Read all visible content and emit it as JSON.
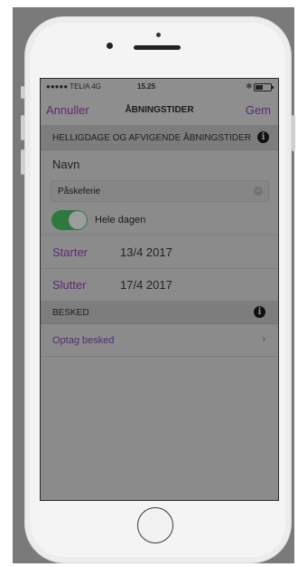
{
  "status_bar": {
    "carrier": "●●●●● TELIA 4G",
    "time": "15.25",
    "bluetooth": "✱"
  },
  "nav": {
    "left_label": "Annuller",
    "title": "ÅBNINGSTIDER",
    "right_label": "Gem"
  },
  "section1": {
    "title": "HELLIGDAGE OG AFVIGENDE ÅBNINGSTIDER"
  },
  "form": {
    "name_label": "Navn",
    "name_value": "Påskeferie",
    "all_day_label": "Hele dagen",
    "all_day_on": true,
    "start_label": "Starter",
    "start_value": "13/4 2017",
    "end_label": "Slutter",
    "end_value": "17/4 2017"
  },
  "section2": {
    "title": "BESKED"
  },
  "message": {
    "record_label": "Optag besked",
    "chevron": "›"
  },
  "icons": {
    "info": "i",
    "clear": "×"
  },
  "colors": {
    "accent": "#5c2a72",
    "toggle_on": "#2e7a3e",
    "overlay": "#8b8b8b"
  }
}
